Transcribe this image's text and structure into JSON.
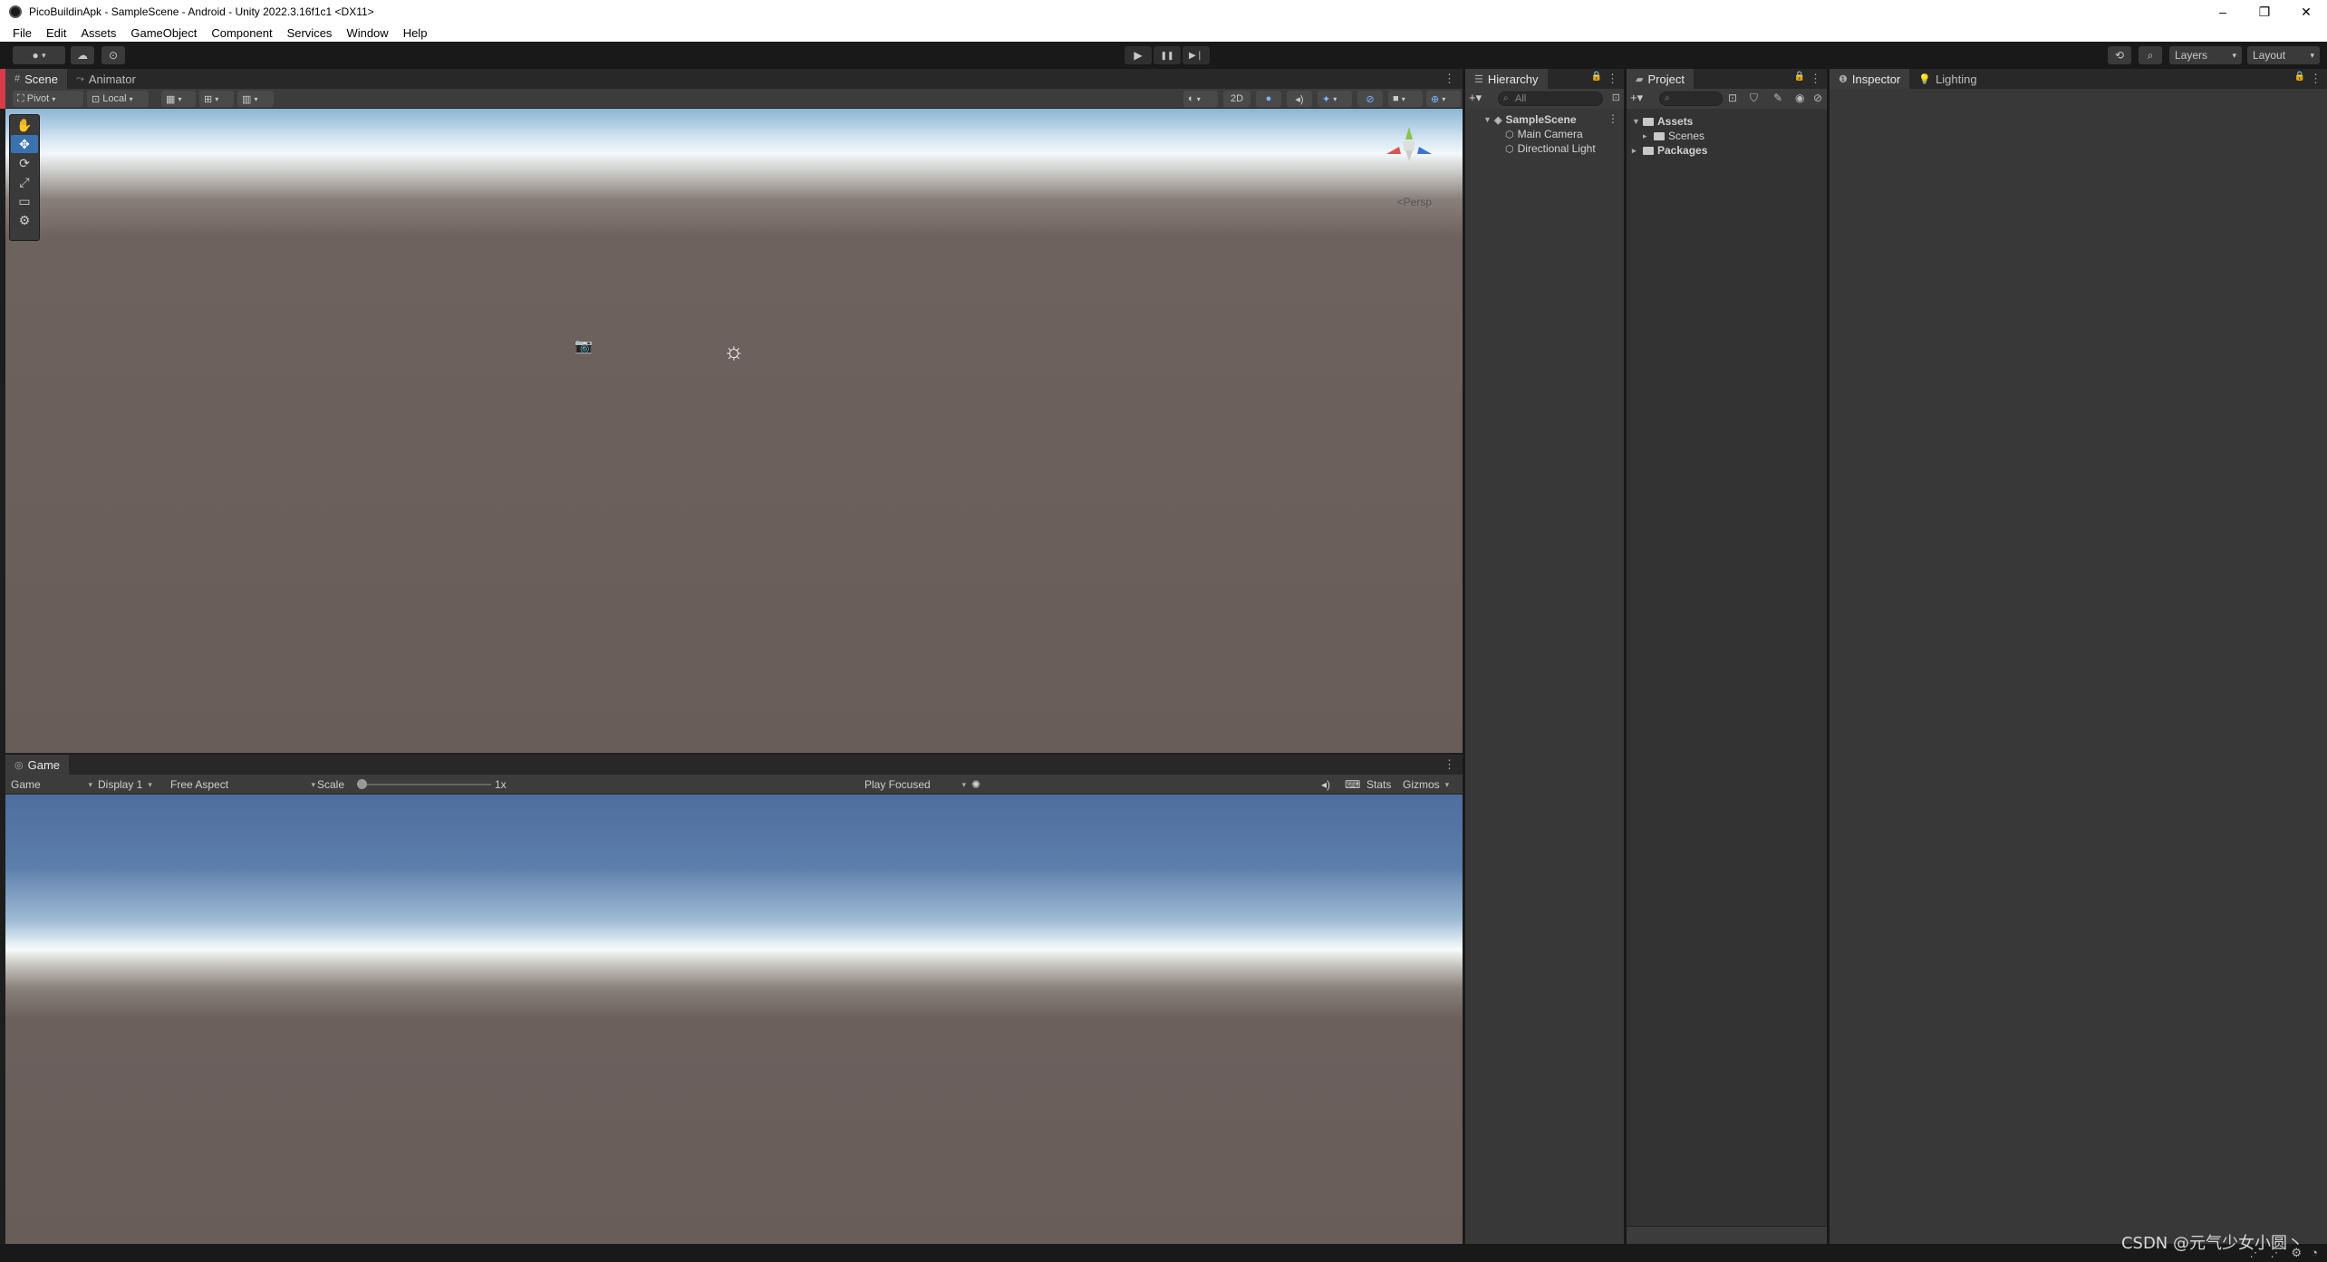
{
  "window": {
    "title": "PicoBuildinApk - SampleScene - Android - Unity 2022.3.16f1c1 <DX11>",
    "controls": {
      "minimize": "–",
      "maximize": "❐",
      "close": "✕"
    }
  },
  "menu": [
    "File",
    "Edit",
    "Assets",
    "GameObject",
    "Component",
    "Services",
    "Window",
    "Help"
  ],
  "toolbar": {
    "account_icon": "account-icon",
    "cloud_icon": "cloud-icon",
    "collab_icon": "collab-icon",
    "play": "▶",
    "pause": "❚❚",
    "step": "▶❘",
    "history_icon": "history-icon",
    "search_icon": "search-icon",
    "layers_label": "Layers",
    "layout_label": "Layout"
  },
  "scene": {
    "tabs": [
      {
        "label": "Scene",
        "icon": "#"
      },
      {
        "label": "Animator",
        "icon": "⤳"
      }
    ],
    "pivot_label": "Pivot",
    "local_label": "Local",
    "twod_label": "2D",
    "persp_label": "<Persp",
    "tools": [
      "✋",
      "✥",
      "⟳",
      "⤢",
      "▭",
      "⚙"
    ]
  },
  "game": {
    "tab_label": "Game",
    "view_mode": "Game",
    "display": "Display 1",
    "aspect": "Free Aspect",
    "scale_label": "Scale",
    "scale_value": "1x",
    "scale_fraction": 0.0,
    "play_mode": "Play Focused",
    "stats_label": "Stats",
    "gizmos_label": "Gizmos"
  },
  "hierarchy": {
    "tab_label": "Hierarchy",
    "search_placeholder": "All",
    "scene_name": "SampleScene",
    "items": [
      "Main Camera",
      "Directional Light"
    ]
  },
  "project": {
    "tab_label": "Project",
    "tree": [
      {
        "label": "Assets",
        "bold": true
      },
      {
        "label": "Scenes",
        "bold": false
      },
      {
        "label": "Packages",
        "bold": true
      }
    ]
  },
  "inspector": {
    "tabs": [
      {
        "label": "Inspector",
        "icon": "❶"
      },
      {
        "label": "Lighting",
        "icon": "💡"
      }
    ]
  },
  "watermark": "CSDN @元气少女小圆丶"
}
